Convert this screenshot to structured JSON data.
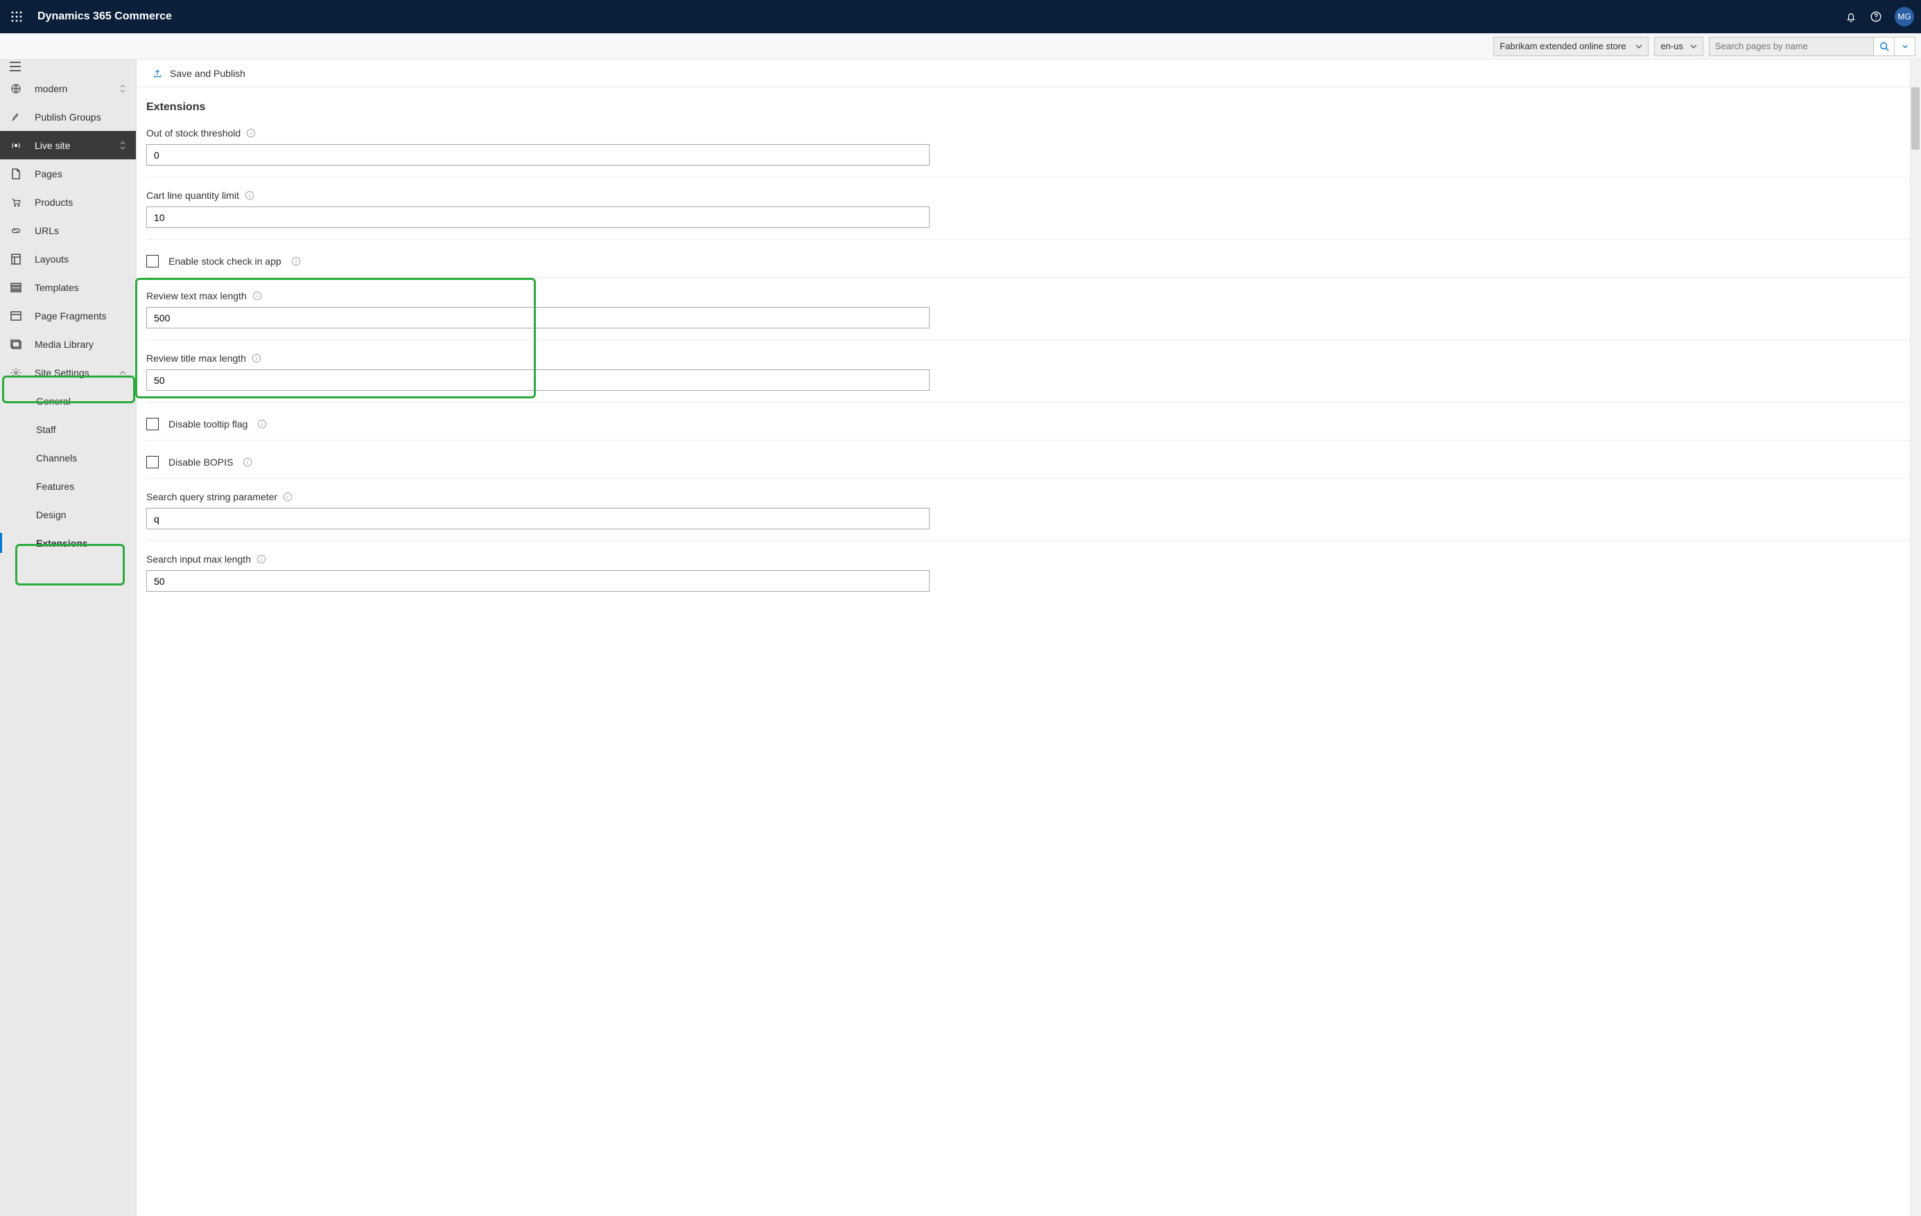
{
  "app": {
    "brand": "Dynamics 365 Commerce",
    "avatar": "MG"
  },
  "secondbar": {
    "store": "Fabrikam extended online store",
    "locale": "en-us",
    "search_placeholder": "Search pages by name"
  },
  "commandbar": {
    "save_publish": "Save and Publish"
  },
  "sidebar": {
    "site": "modern",
    "items": {
      "publish_groups": "Publish Groups",
      "live_site": "Live site",
      "pages": "Pages",
      "products": "Products",
      "urls": "URLs",
      "layouts": "Layouts",
      "templates": "Templates",
      "page_fragments": "Page Fragments",
      "media_library": "Media Library",
      "site_settings": "Site Settings",
      "general": "General",
      "staff": "Staff",
      "channels": "Channels",
      "features": "Features",
      "design": "Design",
      "extensions": "Extensions"
    }
  },
  "page": {
    "title": "Extensions",
    "out_of_stock_label": "Out of stock threshold",
    "out_of_stock_value": "0",
    "cart_line_label": "Cart line quantity limit",
    "cart_line_value": "10",
    "enable_stock_check_label": "Enable stock check in app",
    "review_text_label": "Review text max length",
    "review_text_value": "500",
    "review_title_label": "Review title max length",
    "review_title_value": "50",
    "disable_tooltip_label": "Disable tooltip flag",
    "disable_bopis_label": "Disable BOPIS",
    "search_query_label": "Search query string parameter",
    "search_query_value": "q",
    "search_input_max_label": "Search input max length",
    "search_input_max_value": "50"
  }
}
